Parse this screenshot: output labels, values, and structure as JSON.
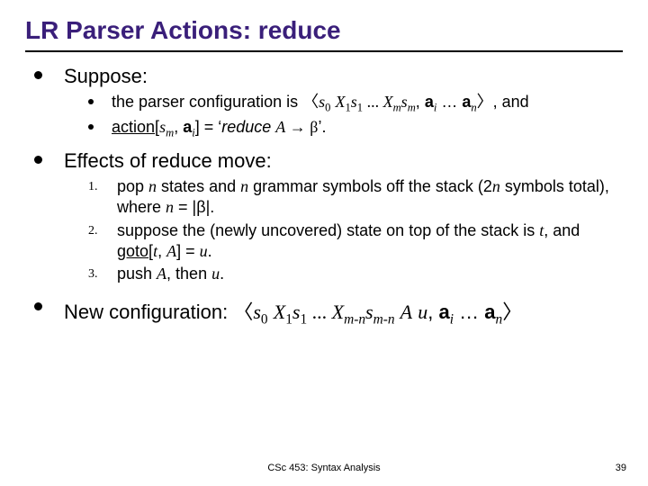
{
  "title": "LR Parser Actions: reduce",
  "suppose_label": "Suppose:",
  "suppose_line1_pre": "the parser configuration is ",
  "suppose_line1_post": ", and",
  "suppose_line2_eq": "] = ‘",
  "suppose_line2_reduce": "reduce",
  "suppose_line2_end": "’.",
  "effects_label": "Effects of reduce move:",
  "eff1_a": "pop ",
  "eff1_b": " states and ",
  "eff1_c": " grammar symbols off the stack (2",
  "eff1_d": " symbols total), where ",
  "eff1_e": " = |β|.",
  "eff2_a": "suppose the (newly uncovered) state on top of the stack is ",
  "eff2_b": ", and ",
  "eff2_c": "] = ",
  "eff2_d": ".",
  "eff3_a": "push ",
  "eff3_b": ", then ",
  "eff3_c": ".",
  "newconf_label": "New configuration: ",
  "footer": "CSc 453: Syntax Analysis",
  "page": "39",
  "sym": {
    "action": "action",
    "goto": "goto",
    "s": "s",
    "X": "X",
    "a": "a",
    "A": "A",
    "u": "u",
    "t": "t",
    "n": "n",
    "m": "m",
    "i": "i",
    "zero": "0",
    "one": "1",
    "arrow": " → ",
    "beta": "β",
    "langle": "〈",
    "rangle": "〉",
    "dots": " … ",
    "ell": " ... ",
    "comma": ",  ",
    "lbr": "[",
    "mn": "m-n"
  }
}
